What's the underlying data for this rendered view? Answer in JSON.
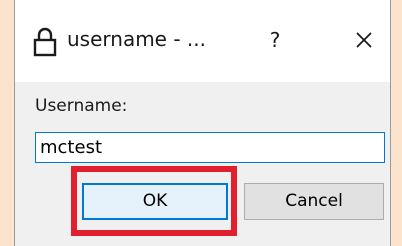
{
  "window": {
    "title": "username - ...",
    "help_label": "?",
    "lock_icon": "lock-icon",
    "close_icon": "close-icon"
  },
  "form": {
    "label": "Username:",
    "value": "mctest"
  },
  "buttons": {
    "ok_label": "OK",
    "cancel_label": "Cancel"
  },
  "colors": {
    "background": "#fbe3cc",
    "highlight": "#e0212d",
    "focus_border": "#0078d7"
  }
}
